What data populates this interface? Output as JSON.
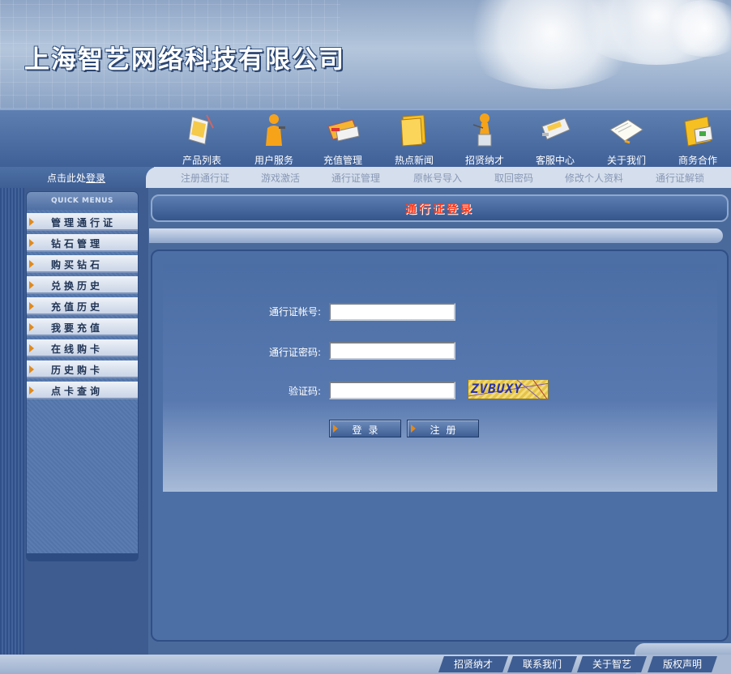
{
  "header": {
    "company_name": "上海智艺网络科技有限公司"
  },
  "nav": [
    {
      "label": "产品列表",
      "icon": "pda-icon"
    },
    {
      "label": "用户服务",
      "icon": "user-service-icon"
    },
    {
      "label": "充值管理",
      "icon": "cards-icon"
    },
    {
      "label": "热点新闻",
      "icon": "folder-icon"
    },
    {
      "label": "招贤纳才",
      "icon": "speaker-icon"
    },
    {
      "label": "客服中心",
      "icon": "phone-icon"
    },
    {
      "label": "关于我们",
      "icon": "notebook-icon"
    },
    {
      "label": "商务合作",
      "icon": "file-folder-icon"
    }
  ],
  "subbar": {
    "login_prefix": "点击此处",
    "login_link": "登录",
    "items": [
      "注册通行证",
      "游戏激活",
      "通行证管理",
      "原帐号导入",
      "取回密码",
      "修改个人资料",
      "通行证解锁"
    ]
  },
  "sidebar": {
    "header": "QUICK MENUS",
    "items": [
      "管理通行证",
      "钻石管理",
      "购买钻石",
      "兑换历史",
      "充值历史",
      "我要充值",
      "在线购卡",
      "历史购卡",
      "点卡查询"
    ]
  },
  "main": {
    "title": "通行证登录",
    "form": {
      "account_label": "通行证帐号:",
      "password_label": "通行证密码:",
      "captcha_label": "验证码:",
      "account_value": "",
      "password_value": "",
      "captcha_value": "",
      "captcha_text": "ZVBUXY",
      "login_button": "登录",
      "register_button": "注册"
    }
  },
  "footer": {
    "links": [
      "招贤纳才",
      "联系我们",
      "关于智艺",
      "版权声明"
    ]
  }
}
